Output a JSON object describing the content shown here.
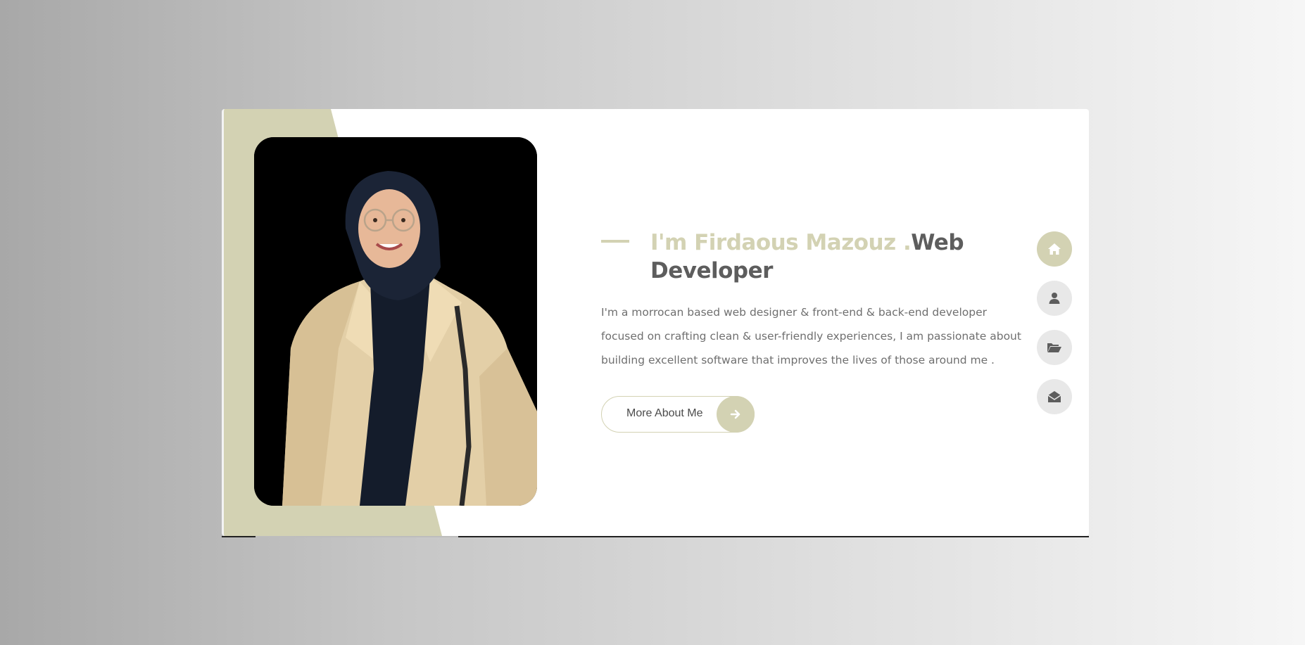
{
  "hero": {
    "title_name": "I'm Firdaous Mazouz .",
    "title_role": "Web Developer",
    "description": "I'm a morrocan based web designer & front-end & back-end developer focused on crafting clean & user-friendly experiences, I am passionate about building excellent software that improves the lives of those around me .",
    "button_label": "More About Me",
    "button_icon": "arrow-right-icon",
    "photo_alt": "portrait"
  },
  "side_nav": [
    {
      "icon": "home-icon",
      "active": true
    },
    {
      "icon": "user-icon",
      "active": false
    },
    {
      "icon": "folder-open-icon",
      "active": false
    },
    {
      "icon": "envelope-open-icon",
      "active": false
    }
  ],
  "colors": {
    "accent": "#d3d2b3",
    "heading_dark": "#5d5d5d",
    "text": "#6f6f6f",
    "nav_inactive": "#e8e8e8"
  }
}
